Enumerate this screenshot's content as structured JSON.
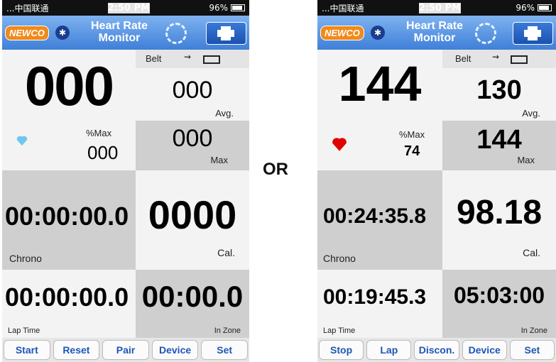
{
  "status": {
    "carrier": "...中国联通",
    "time": "2:50 PM",
    "battery": "96%"
  },
  "header": {
    "logo": "NEWCO",
    "bluetooth": "✱",
    "title_line1": "Heart Rate",
    "title_line2": "Monitor"
  },
  "separator": "OR",
  "left": {
    "bpm": "000",
    "belt_label": "Belt",
    "avg_value": "000",
    "avg_label": "Avg.",
    "max_value": "000",
    "max_label": "Max",
    "pct_label": "%Max",
    "pct_value": "000",
    "chrono_value": "00:00:00.0",
    "chrono_label": "Chrono",
    "cal_value": "0000",
    "cal_label": "Cal.",
    "lap_value": "00:00:00.0",
    "lap_label": "Lap Time",
    "zone_value": "00:00.0",
    "zone_label": "In Zone",
    "buttons": [
      "Start",
      "Reset",
      "Pair",
      "Device",
      "Set"
    ]
  },
  "right": {
    "bpm": "144",
    "belt_label": "Belt",
    "avg_value": "130",
    "avg_label": "Avg.",
    "max_value": "144",
    "max_label": "Max",
    "pct_label": "%Max",
    "pct_value": "74",
    "chrono_value": "00:24:35.8",
    "chrono_label": "Chrono",
    "cal_value": "98.18",
    "cal_label": "Cal.",
    "lap_value": "00:19:45.3",
    "lap_label": "Lap Time",
    "zone_value": "05:03:00",
    "zone_label": "In Zone",
    "buttons": [
      "Stop",
      "Lap",
      "Discon.",
      "Device",
      "Set"
    ]
  }
}
